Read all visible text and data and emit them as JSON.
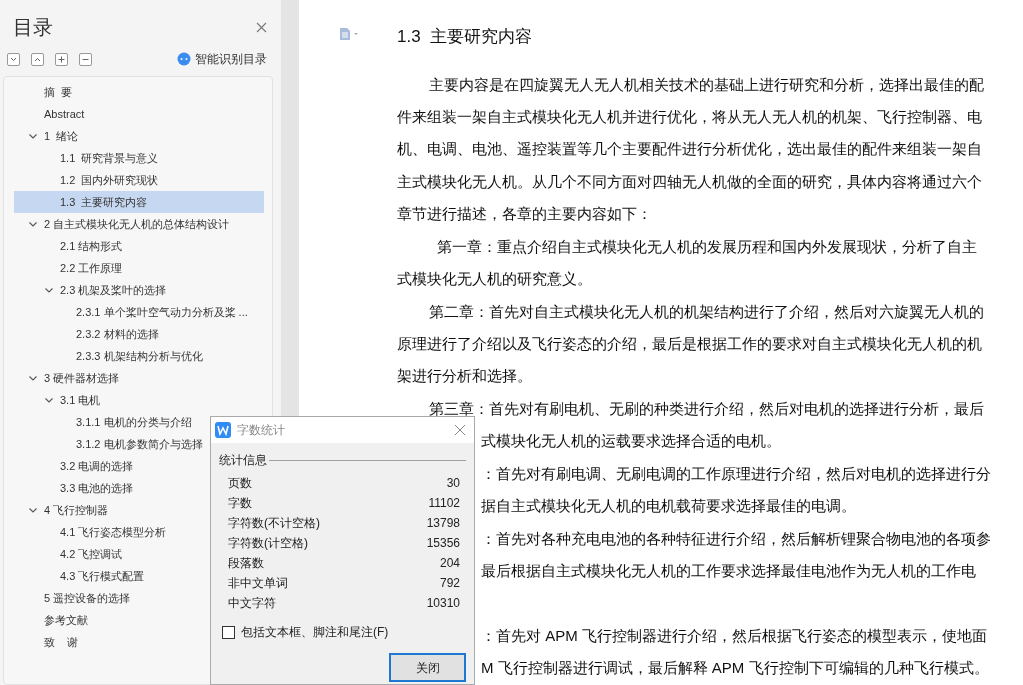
{
  "sidebar": {
    "title": "目录",
    "smart_button": "智能识别目录",
    "items": [
      {
        "label": "摘  要"
      },
      {
        "label": "Abstract"
      },
      {
        "label": "1  绪论",
        "expanded": true,
        "children": [
          {
            "label": "1.1  研究背景与意义",
            "selected": false
          },
          {
            "label": "1.2  国内外研究现状",
            "selected": false
          },
          {
            "label": "1.3  主要研究内容",
            "selected": true
          }
        ]
      },
      {
        "label": "2 自主式模块化无人机的总体结构设计",
        "expanded": true,
        "children": [
          {
            "label": "2.1 结构形式"
          },
          {
            "label": "2.2 工作原理"
          },
          {
            "label": "2.3 机架及桨叶的选择",
            "expanded": true,
            "children": [
              {
                "label": "2.3.1 单个桨叶空气动力分析及桨 ..."
              },
              {
                "label": "2.3.2 材料的选择"
              },
              {
                "label": "2.3.3 机架结构分析与优化"
              }
            ]
          }
        ]
      },
      {
        "label": "3 硬件器材选择",
        "expanded": true,
        "children": [
          {
            "label": "3.1 电机",
            "expanded": true,
            "children": [
              {
                "label": "3.1.1 电机的分类与介绍"
              },
              {
                "label": "3.1.2 电机参数简介与选择"
              }
            ]
          },
          {
            "label": "3.2 电调的选择"
          },
          {
            "label": "3.3 电池的选择"
          }
        ]
      },
      {
        "label": "4 飞行控制器",
        "expanded": true,
        "children": [
          {
            "label": "4.1 飞行姿态模型分析"
          },
          {
            "label": "4.2 飞控调试"
          },
          {
            "label": "4.3 飞行模式配置"
          }
        ]
      },
      {
        "label": "5 遥控设备的选择"
      },
      {
        "label": "参考文献"
      },
      {
        "label": "致    谢"
      }
    ]
  },
  "document": {
    "heading": "1.3  主要研究内容",
    "lines": [
      {
        "kind": "indent",
        "text": "主要内容是在四旋翼无人无人机相关技术的基础上进行研究和分析，选择出最佳的配"
      },
      {
        "kind": "full",
        "text": "件来组装一架自主式模块化无人机并进行优化，将从无人无人机的机架、飞行控制器、电"
      },
      {
        "kind": "full",
        "text": "机、电调、电池、遥控装置等几个主要配件进行分析优化，选出最佳的配件来组装一架自"
      },
      {
        "kind": "full",
        "text": "主式模块化无人机。从几个不同方面对四轴无人机做的全面的研究，具体内容将通过六个"
      },
      {
        "kind": "full",
        "text": "章节进行描述，各章的主要内容如下："
      },
      {
        "kind": "deep",
        "text": "第一章：重点介绍自主式模块化无人机的发展历程和国内外发展现状，分析了自主"
      },
      {
        "kind": "full",
        "text": "式模块化无人机的研究意义。"
      },
      {
        "kind": "indent",
        "text": "第二章：首先对自主式模块化无人机的机架结构进行了介绍，然后对六旋翼无人机的"
      },
      {
        "kind": "full",
        "text": "原理进行了介绍以及飞行姿态的介绍，最后是根据工作的要求对自主式模块化无人机的机"
      },
      {
        "kind": "full",
        "text": "架进行分析和选择。"
      },
      {
        "kind": "indent",
        "text": "第三章：首先对有刷电机、无刷的种类进行介绍，然后对电机的选择进行分析，最后"
      },
      {
        "kind": "partial",
        "text": "式模块化无人机的运载要求选择合适的电机。"
      },
      {
        "kind": "partial",
        "text": "：首先对有刷电调、无刷电调的工作原理进行介绍，然后对电机的选择进行分"
      },
      {
        "kind": "partial",
        "text": "据自主式模块化无人机的电机载荷要求选择最佳的电调。"
      },
      {
        "kind": "partial",
        "text": "：首先对各种充电电池的各种特征进行介绍，然后解析锂聚合物电池的各项参"
      },
      {
        "kind": "partial",
        "text": "最后根据自主式模块化无人机的工作要求选择最佳电池作为无人机的工作电"
      },
      {
        "kind": "blank"
      },
      {
        "kind": "partial",
        "text": "：首先对 APM 飞行控制器进行介绍，然后根据飞行姿态的模型表示，使地面"
      },
      {
        "kind": "partial",
        "text": "M 飞行控制器进行调试，最后解释 APM 飞行控制下可编辑的几种飞行模式。"
      }
    ]
  },
  "dialog": {
    "title": "字数统计",
    "group": "统计信息",
    "rows": [
      {
        "label": "页数",
        "value": "30"
      },
      {
        "label": "字数",
        "value": "11102"
      },
      {
        "label": "字符数(不计空格)",
        "value": "13798"
      },
      {
        "label": "字符数(计空格)",
        "value": "15356"
      },
      {
        "label": "段落数",
        "value": "204"
      },
      {
        "label": "非中文单词",
        "value": "792"
      },
      {
        "label": "中文字符",
        "value": "10310"
      }
    ],
    "checkbox": {
      "label": "包括文本框、脚注和尾注(F)",
      "checked": false
    },
    "button": "关闭"
  }
}
